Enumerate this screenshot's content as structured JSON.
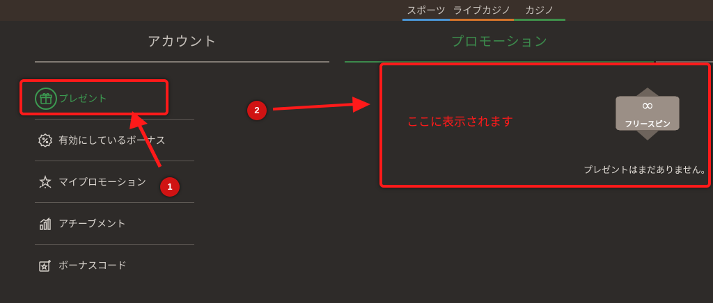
{
  "top_nav": {
    "sports": "スポーツ",
    "live_casino": "ライブカジノ",
    "casino": "カジノ"
  },
  "tabs": {
    "account": "アカウント",
    "promotion": "プロモーション"
  },
  "sidebar": {
    "items": [
      {
        "label": "プレゼント",
        "icon": "gift-icon",
        "active": true
      },
      {
        "label": "有効にしているボーナス",
        "icon": "bonus-badge-icon"
      },
      {
        "label": "マイプロモーション",
        "icon": "sparkle-star-icon"
      },
      {
        "label": "アチーブメント",
        "icon": "bar-chart-icon"
      },
      {
        "label": "ボーナスコード",
        "icon": "star-code-icon"
      }
    ]
  },
  "annotations": {
    "badge1": "1",
    "badge2": "2",
    "display_here": "ここに表示されます"
  },
  "content": {
    "free_spin_symbol": "∞",
    "free_spin_label": "フリースピン",
    "empty_message": "プレゼントはまだありません。"
  },
  "colors": {
    "background": "#2e2b29",
    "accent_green": "#3c8a4c",
    "annotation_red": "#ff1a1a"
  }
}
